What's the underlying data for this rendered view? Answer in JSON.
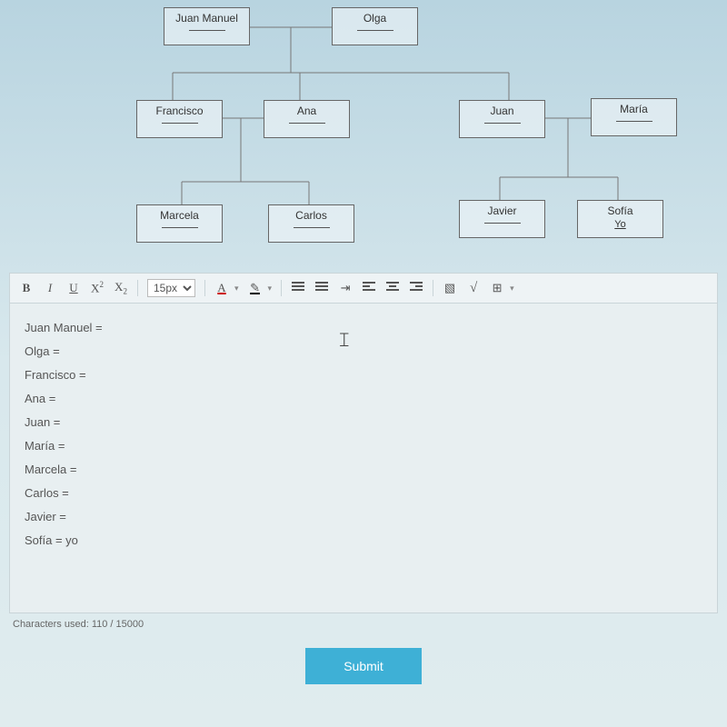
{
  "tree": {
    "juan_manuel": "Juan Manuel",
    "olga": "Olga",
    "francisco": "Francisco",
    "ana": "Ana",
    "juan": "Juan",
    "maria": "María",
    "marcela": "Marcela",
    "carlos": "Carlos",
    "javier": "Javier",
    "sofia": "Sofía",
    "sofia_sub": "Yo"
  },
  "toolbar": {
    "bold": "B",
    "italic": "I",
    "underline": "U",
    "sup": "X",
    "sup_s": "2",
    "sub": "X",
    "sub_s": "2",
    "size": "15px",
    "textcolor": "A",
    "highlight": "✎",
    "ul": "≣",
    "ol": "≣",
    "outdent": "⭾",
    "align_left": "▌",
    "align_center": "▐",
    "align_right": "▐",
    "image": "🖼",
    "equation": "√",
    "table": "⊞"
  },
  "editor": {
    "lines": [
      "Juan Manuel =",
      "Olga =",
      "Francisco =",
      "Ana =",
      "Juan =",
      "María =",
      "Marcela =",
      "Carlos =",
      "Javier =",
      "Sofía = yo"
    ]
  },
  "meta": {
    "chars": "Characters used: 110 / 15000"
  },
  "submit": {
    "label": "Submit"
  }
}
